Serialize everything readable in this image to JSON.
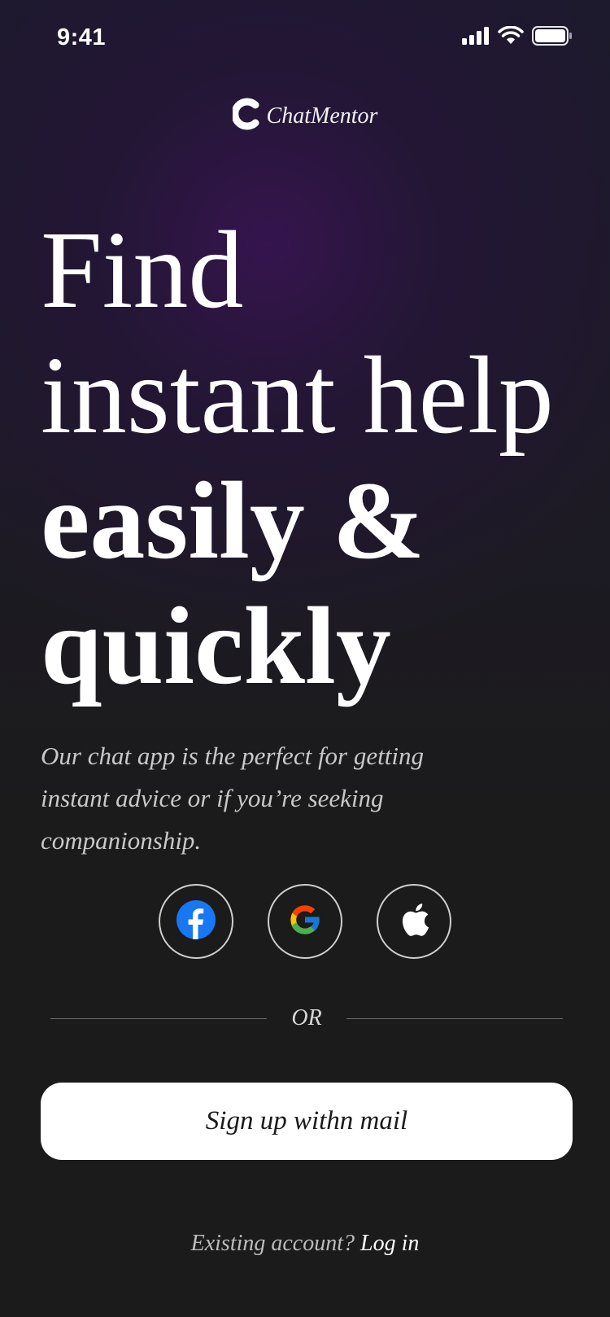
{
  "status_bar": {
    "time": "9:41",
    "icons": [
      "signal-icon",
      "wifi-icon",
      "battery-icon"
    ]
  },
  "brand": {
    "name": "ChatMentor",
    "logo_icon": "c-logo-icon"
  },
  "hero": {
    "line1": "Find",
    "line2": "instant help",
    "line3": "easily &",
    "line4": "quickly",
    "subtitle": "Our chat app is the perfect for getting instant advice or if you’re seeking companionship."
  },
  "social": {
    "buttons": [
      {
        "name": "facebook",
        "icon": "facebook-icon",
        "color": "#1877F2"
      },
      {
        "name": "google",
        "icon": "google-icon",
        "color": "#4285F4"
      },
      {
        "name": "apple",
        "icon": "apple-icon",
        "color": "#FFFFFF"
      }
    ]
  },
  "divider": {
    "label": "OR"
  },
  "signup": {
    "label": "Sign up withn mail"
  },
  "login": {
    "prompt": "Existing account?",
    "link": "Log in"
  },
  "colors": {
    "background": "#1B1B1C",
    "accent_glow": "#371450",
    "button_bg": "#FFFFFF",
    "text": "#FFFFFF"
  }
}
